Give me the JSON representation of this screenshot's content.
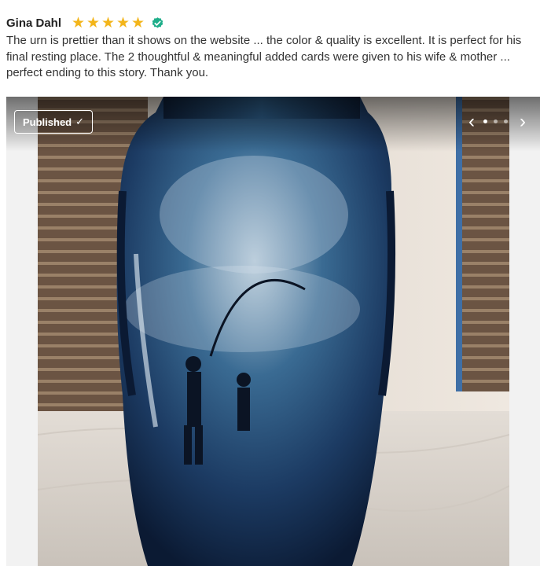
{
  "review": {
    "author": "Gina Dahl",
    "rating": 5,
    "stars": [
      "★",
      "★",
      "★",
      "★",
      "★"
    ],
    "verified_icon": "verified-check-icon",
    "text": "The urn is prettier than it shows on the website ... the color & quality is excellent. It is perfect for his final resting place. The 2 thoughtful & meaningful added cards were given to his wife & mother ... perfect ending to this story. Thank you."
  },
  "photo": {
    "badge_label": "Published",
    "badge_icon": "✓",
    "prev_icon": "‹",
    "next_icon": "›",
    "slide_count": 3,
    "current_slide": 1
  },
  "colors": {
    "star": "#f3b51a",
    "verified": "#1fae8a"
  }
}
